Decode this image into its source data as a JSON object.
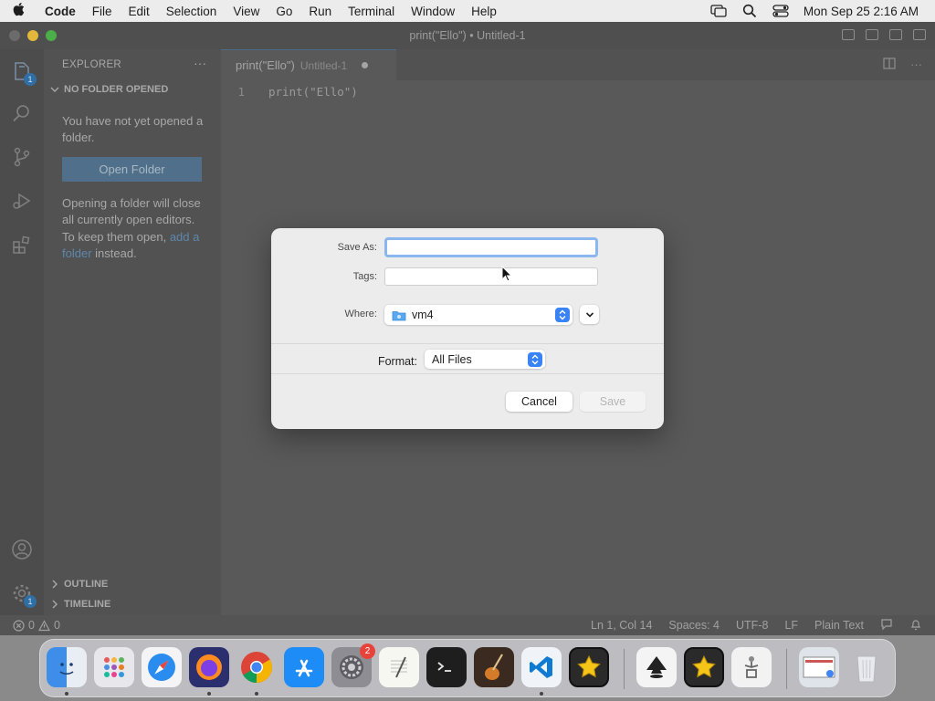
{
  "menubar": {
    "app_name": "Code",
    "items": [
      "File",
      "Edit",
      "Selection",
      "View",
      "Go",
      "Run",
      "Terminal",
      "Window",
      "Help"
    ],
    "datetime": "Mon Sep 25  2:16 AM"
  },
  "window": {
    "title": "print(\"Ello\") • Untitled-1"
  },
  "sidebar": {
    "title": "EXPLORER",
    "more": "···",
    "section_title": "NO FOLDER OPENED",
    "message": "You have not yet opened a folder.",
    "open_folder_label": "Open Folder",
    "hint_prefix": "Opening a folder will close all currently open editors. To keep them open,",
    "hint_link": "add a folder",
    "hint_suffix": "instead.",
    "outline_label": "OUTLINE",
    "timeline_label": "TIMELINE"
  },
  "activitybar": {
    "explorer_badge": "1",
    "settings_badge": "1"
  },
  "editor": {
    "tab_title": "print(\"Ello\")",
    "tab_description": "Untitled-1",
    "line_number": "1",
    "line_text": "print(\"Ello\")"
  },
  "statusbar": {
    "errors": "0",
    "warnings": "0",
    "position": "Ln 1, Col 14",
    "spaces": "Spaces: 4",
    "encoding": "UTF-8",
    "eol": "LF",
    "language": "Plain Text"
  },
  "dialog": {
    "save_as_label": "Save As:",
    "save_as_value": "",
    "tags_label": "Tags:",
    "where_label": "Where:",
    "where_value": "vm4",
    "format_label": "Format:",
    "format_value": "All Files",
    "cancel_label": "Cancel",
    "save_label": "Save"
  },
  "dock": {
    "system_settings_badge": "2",
    "apps": [
      "Finder",
      "Launchpad",
      "Safari",
      "Firefox",
      "Chrome",
      "App Store",
      "System Settings",
      "TextEdit",
      "Terminal",
      "Instruments",
      "Visual Studio Code",
      "Photo Slideshow",
      "Inkscape",
      "Photo Slideshow",
      "Automator",
      "Screenshot",
      "Trash"
    ]
  },
  "colors": {
    "accent": "#3a82f7",
    "focus_ring": "#8ab7ef"
  }
}
